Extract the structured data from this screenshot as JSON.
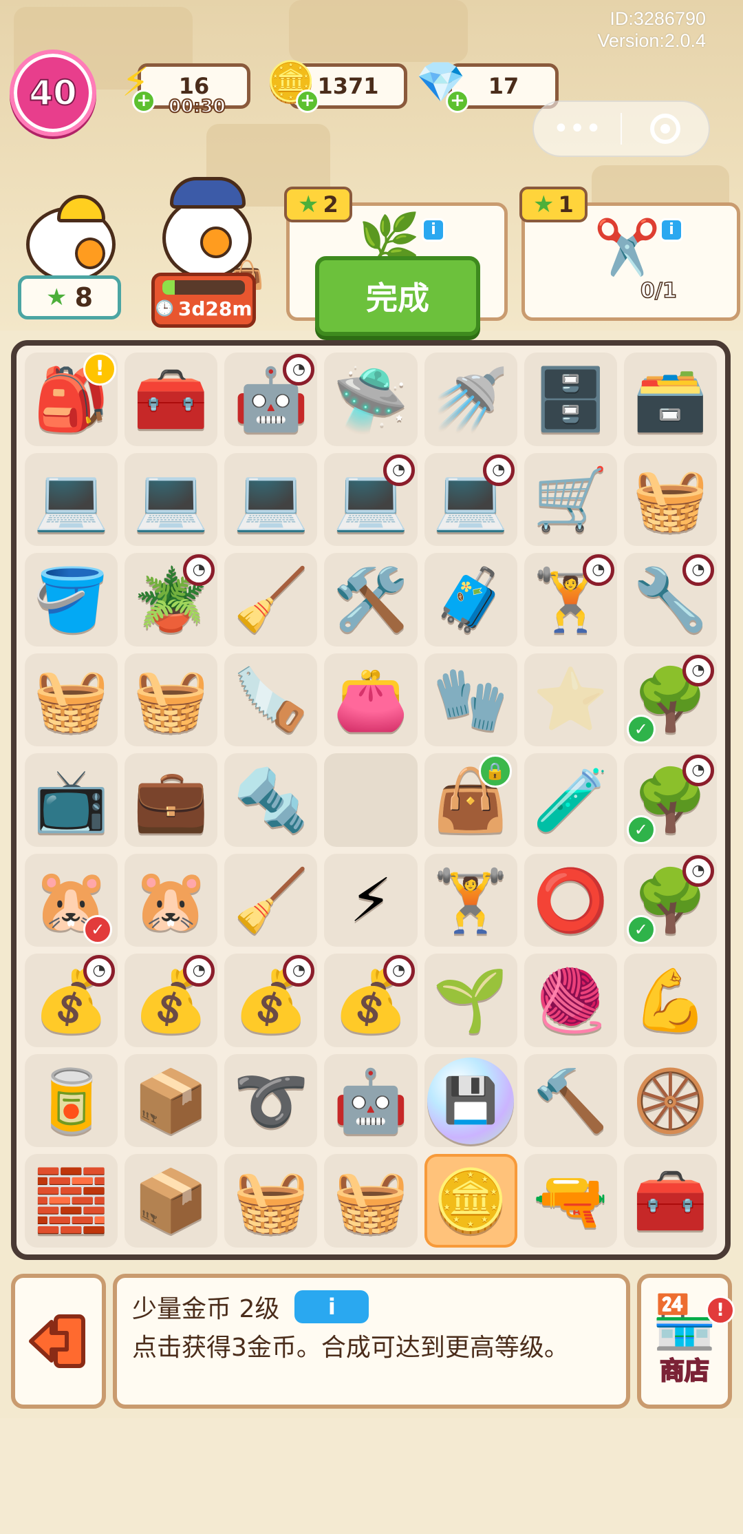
{
  "meta": {
    "id_text": "ID:3286790",
    "version_text": "Version:2.0.4"
  },
  "player": {
    "level": "40"
  },
  "resources": {
    "energy": {
      "value": "16",
      "timer": "00:30",
      "icon": "lightning-icon"
    },
    "coins": {
      "value": "1371",
      "icon": "coin-icon"
    },
    "gems": {
      "value": "17",
      "icon": "gem-icon"
    }
  },
  "characters": {
    "worker": {
      "badge_value": "8"
    },
    "conductor": {
      "timer": "3d28m",
      "progress": 0.15
    }
  },
  "orders": [
    {
      "stars": "2",
      "done_label": "完成",
      "item": "bush-icon"
    },
    {
      "stars": "1",
      "progress": "0/1",
      "item": "pruning-shears-icon"
    }
  ],
  "board": {
    "rows": [
      [
        {
          "icon": "🎒",
          "name": "backpack",
          "alert": true
        },
        {
          "icon": "🧰",
          "name": "toolbox"
        },
        {
          "icon": "🤖",
          "name": "robot-vacuum",
          "clock": true
        },
        {
          "icon": "🛸",
          "name": "robot-vacuum-2"
        },
        {
          "icon": "🚿",
          "name": "vacuum-base"
        },
        {
          "icon": "🗄️",
          "name": "cabinet"
        },
        {
          "icon": "🗃️",
          "name": "drawer-cabinet"
        }
      ],
      [
        {
          "icon": "💻",
          "name": "laptop"
        },
        {
          "icon": "💻",
          "name": "laptop"
        },
        {
          "icon": "💻",
          "name": "laptop"
        },
        {
          "icon": "💻",
          "name": "laptop",
          "clock": true
        },
        {
          "icon": "💻",
          "name": "laptop",
          "clock": true
        },
        {
          "icon": "🛒",
          "name": "shopping-cart"
        },
        {
          "icon": "🧺",
          "name": "shopping-basket"
        }
      ],
      [
        {
          "icon": "🪣",
          "name": "bucket"
        },
        {
          "icon": "🪴",
          "name": "sprout-pot",
          "clock": true
        },
        {
          "icon": "🧹",
          "name": "tool-bucket"
        },
        {
          "icon": "🛠️",
          "name": "wheelbarrow-tools"
        },
        {
          "icon": "🧳",
          "name": "tool-case"
        },
        {
          "icon": "🏋️",
          "name": "dumbbell-cart",
          "clock": true
        },
        {
          "icon": "🔧",
          "name": "dumbbell-cart-2",
          "clock": true
        }
      ],
      [
        {
          "icon": "🧺",
          "name": "flower-basket"
        },
        {
          "icon": "🧺",
          "name": "flower-basket"
        },
        {
          "icon": "🪚",
          "name": "electric-drill"
        },
        {
          "icon": "👛",
          "name": "pink-bag",
          "glow": true
        },
        {
          "icon": "🧤",
          "name": "gloves"
        },
        {
          "icon": "⭐",
          "name": "locked-slot",
          "ghost": true
        },
        {
          "icon": "🌳",
          "name": "potted-tree",
          "clock": true,
          "check": true
        }
      ],
      [
        {
          "icon": "📺",
          "name": "tv"
        },
        {
          "icon": "💼",
          "name": "folding-case"
        },
        {
          "icon": "🔩",
          "name": "wrench"
        },
        {
          "icon": "",
          "name": "empty-cell"
        },
        {
          "icon": "👜",
          "name": "black-bag",
          "lock": true
        },
        {
          "icon": "🧪",
          "name": "capacitor"
        },
        {
          "icon": "🌳",
          "name": "potted-tree",
          "clock": true,
          "check": true
        }
      ],
      [
        {
          "icon": "🐹",
          "name": "hamster-group",
          "redcheck": true
        },
        {
          "icon": "🐹",
          "name": "hamster-pair"
        },
        {
          "icon": "🧹",
          "name": "dustpan"
        },
        {
          "icon": "⚡",
          "name": "energy-orb"
        },
        {
          "icon": "🏋️",
          "name": "blue-dumbbell"
        },
        {
          "icon": "⭕",
          "name": "hula-hoop"
        },
        {
          "icon": "🌳",
          "name": "potted-tree",
          "clock": true,
          "check": true
        }
      ],
      [
        {
          "icon": "💰",
          "name": "garbage-bag",
          "clock": true
        },
        {
          "icon": "💰",
          "name": "garbage-bag",
          "clock": true
        },
        {
          "icon": "💰",
          "name": "garbage-bag",
          "clock": true
        },
        {
          "icon": "💰",
          "name": "garbage-bag",
          "clock": true
        },
        {
          "icon": "🌱",
          "name": "small-plant"
        },
        {
          "icon": "🧶",
          "name": "yarn-ball"
        },
        {
          "icon": "💪",
          "name": "hand-grip"
        }
      ],
      [
        {
          "icon": "🥫",
          "name": "paint-can"
        },
        {
          "icon": "📦",
          "name": "tool-box-open"
        },
        {
          "icon": "➰",
          "name": "rope"
        },
        {
          "icon": "🤖",
          "name": "robot-vacuum"
        },
        {
          "icon": "💾",
          "name": "cpu-bubble",
          "bubble": true
        },
        {
          "icon": "🔨",
          "name": "hammer"
        },
        {
          "icon": "🛞",
          "name": "ab-wheel"
        }
      ],
      [
        {
          "icon": "🧱",
          "name": "sacks"
        },
        {
          "icon": "📦",
          "name": "cardboard-box"
        },
        {
          "icon": "🧺",
          "name": "red-basket"
        },
        {
          "icon": "🧺",
          "name": "yellow-basket"
        },
        {
          "icon": "🪙",
          "name": "coins",
          "highlight": true
        },
        {
          "icon": "🔫",
          "name": "massage-gun"
        },
        {
          "icon": "🧰",
          "name": "purple-basket"
        }
      ]
    ]
  },
  "selected_item": {
    "title": "少量金币 2级",
    "info_label": "i",
    "description": "点击获得3金币。合成可达到更高等级。"
  },
  "shop": {
    "label": "商店"
  },
  "colors": {
    "accent_green": "#6cc13c",
    "board_border": "#4a3a34",
    "level_pink": "#e83e8c"
  }
}
